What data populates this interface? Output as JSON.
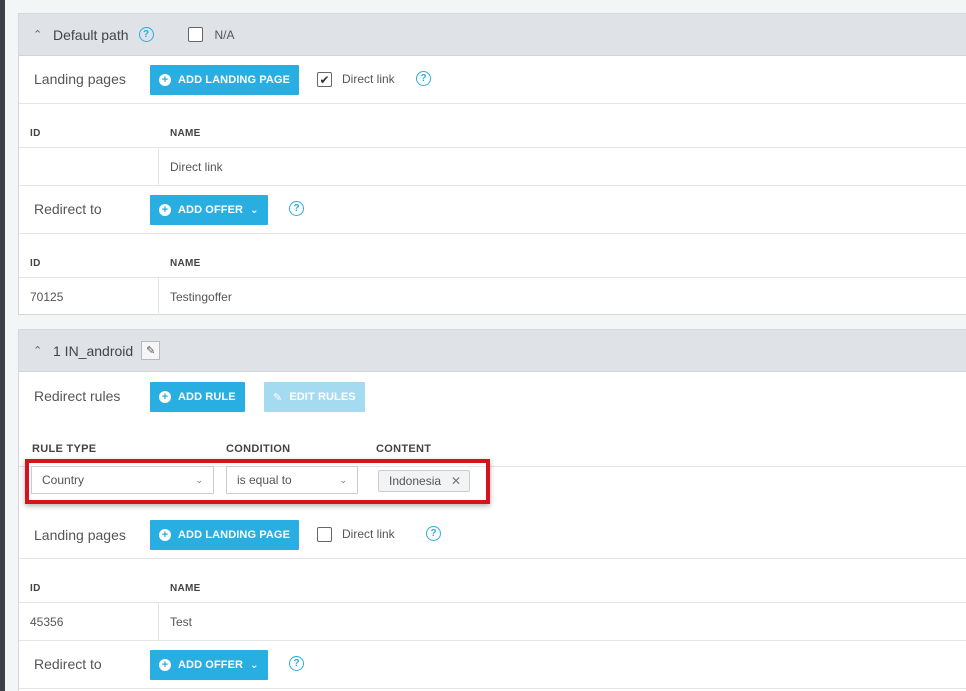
{
  "section1": {
    "title": "Default path",
    "na_label": "N/A",
    "landing": {
      "label": "Landing pages",
      "add_button": "ADD LANDING PAGE",
      "direct_link_label": "Direct link",
      "direct_link_checked": true,
      "columns": [
        "ID",
        "NAME"
      ],
      "rows": [
        {
          "id": "",
          "name": "Direct link"
        }
      ]
    },
    "redirect": {
      "label": "Redirect to",
      "add_button": "ADD OFFER",
      "columns": [
        "ID",
        "NAME"
      ],
      "rows": [
        {
          "id": "70125",
          "name": "Testingoffer"
        }
      ]
    }
  },
  "section2": {
    "title": "1 IN_android",
    "rules": {
      "label": "Redirect rules",
      "add_button": "ADD RULE",
      "edit_button": "EDIT RULES",
      "columns": [
        "RULE TYPE",
        "CONDITION",
        "CONTENT"
      ],
      "rule_type": "Country",
      "condition": "is equal to",
      "content_tag": "Indonesia"
    },
    "landing": {
      "label": "Landing pages",
      "add_button": "ADD LANDING PAGE",
      "direct_link_label": "Direct link",
      "direct_link_checked": false,
      "columns": [
        "ID",
        "NAME"
      ],
      "rows": [
        {
          "id": "45356",
          "name": "Test"
        }
      ]
    },
    "redirect": {
      "label": "Redirect to",
      "add_button": "ADD OFFER"
    }
  },
  "colors": {
    "accent": "#29aee2",
    "highlight": "#d4141c",
    "header_bg": "#dfe2e6"
  },
  "icons": {
    "caret": "chevron-up-icon",
    "help": "question-circle-icon",
    "add": "plus-circle-icon",
    "edit": "pencil-icon",
    "dropdown": "chevron-down-icon",
    "remove": "close-icon"
  }
}
